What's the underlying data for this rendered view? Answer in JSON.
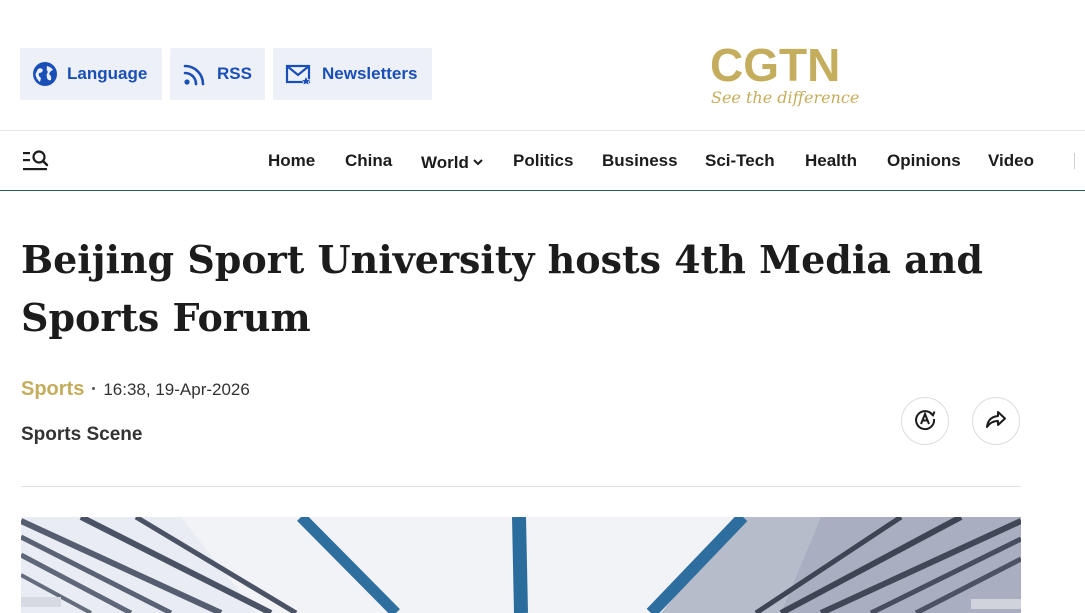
{
  "header": {
    "language_label": "Language",
    "rss_label": "RSS",
    "newsletters_label": "Newsletters",
    "logo_text": "CGTN",
    "logo_tagline": "See the difference"
  },
  "nav": {
    "items": [
      {
        "label": "Home"
      },
      {
        "label": "China"
      },
      {
        "label": "World"
      },
      {
        "label": "Politics"
      },
      {
        "label": "Business"
      },
      {
        "label": "Sci-Tech"
      },
      {
        "label": "Health"
      },
      {
        "label": "Opinions"
      },
      {
        "label": "Video"
      }
    ]
  },
  "article": {
    "headline": "Beijing Sport University hosts 4th Media and Sports Forum",
    "category": "Sports",
    "datetime": "16:38, 19-Apr-2026",
    "column": "Sports Scene"
  },
  "colors": {
    "brand_gold": "#c4ad5c",
    "link_blue": "#1a4fb8",
    "nav_border": "#2a5c4a"
  },
  "icons": {
    "language": "globe-icon",
    "rss": "rss-icon",
    "newsletters": "mail-icon",
    "menu_search": "menu-search-icon",
    "accessibility": "read-aloud-icon",
    "share": "share-icon"
  }
}
